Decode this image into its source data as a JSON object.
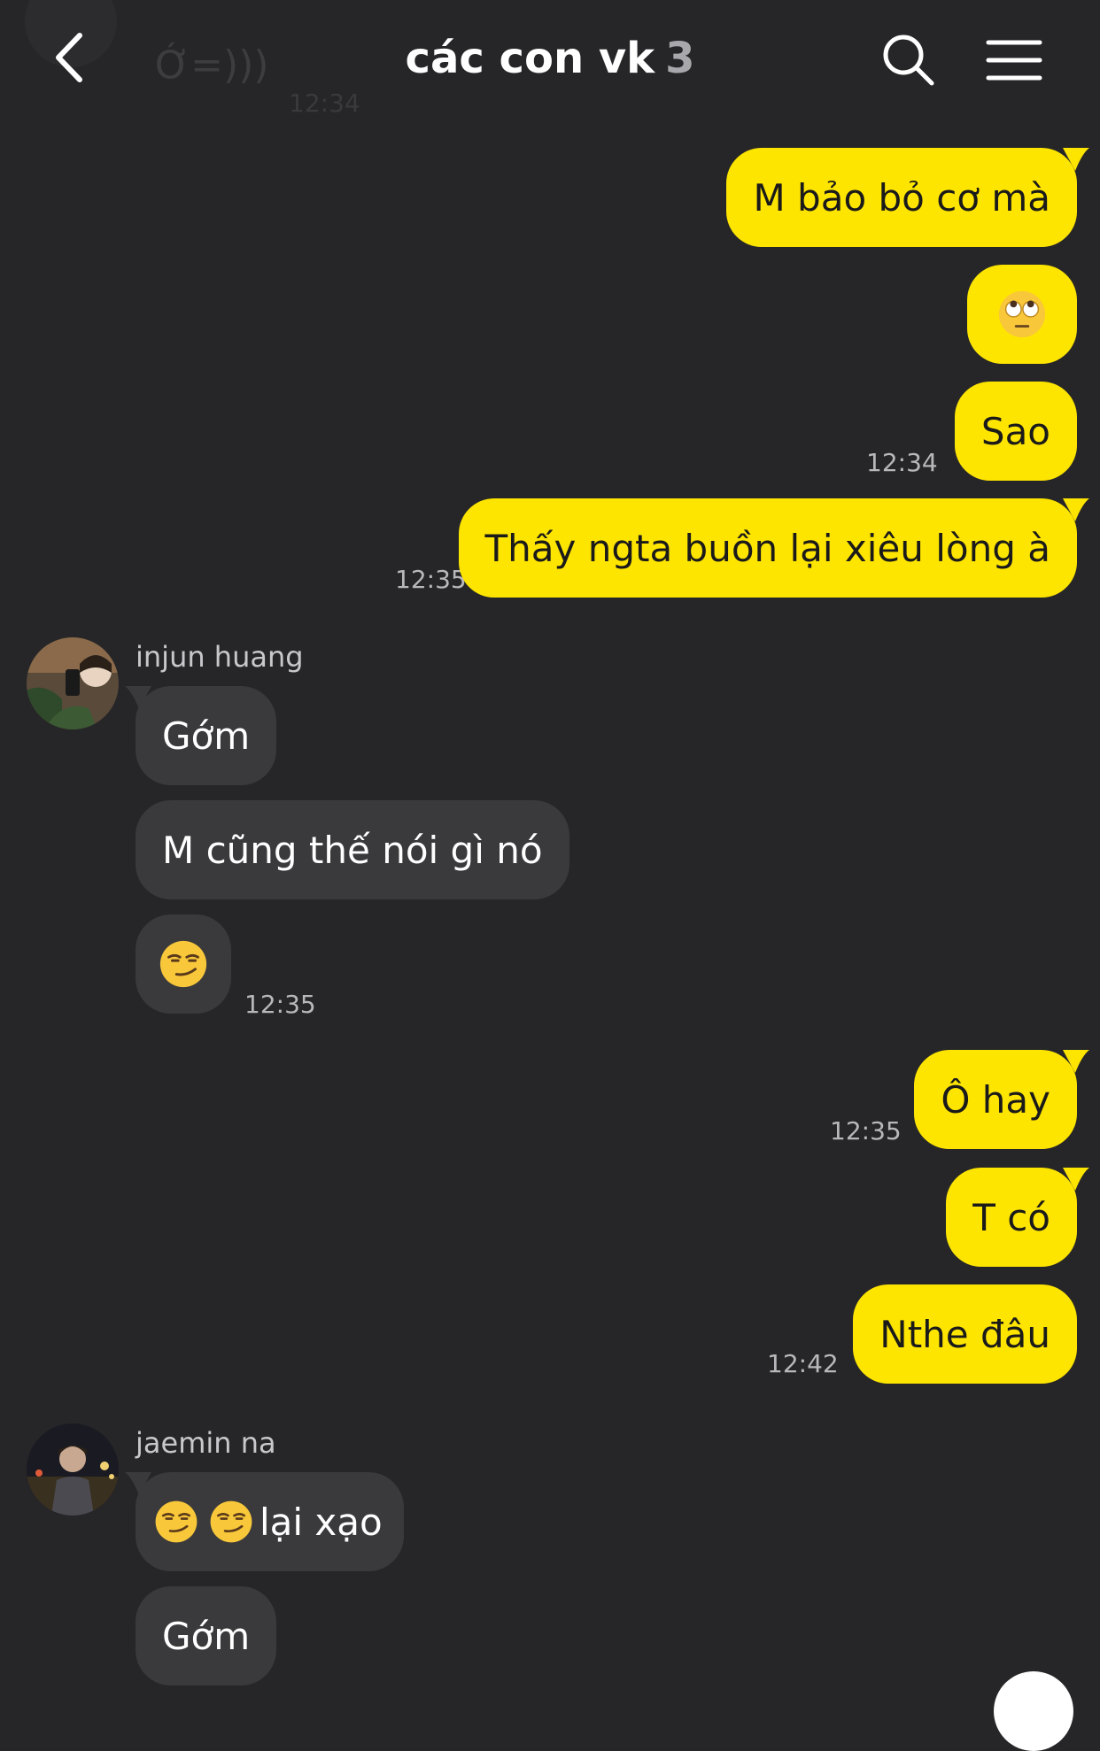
{
  "header": {
    "title": "các con vk",
    "member_count": "3",
    "prev_message_text": "Ớ=)))",
    "prev_message_time": "12:34"
  },
  "messages": {
    "m1": {
      "text": "M bảo bỏ cơ mà"
    },
    "m2": {
      "emoji": "face-with-rolling-eyes"
    },
    "m3": {
      "text": "Sao",
      "time": "12:34"
    },
    "m4": {
      "text": "Thấy ngta buồn lại xiêu lòng à",
      "time": "12:35"
    },
    "g1": {
      "sender": "injun huang",
      "b1": "Gớm",
      "b2": "M cũng thế nói gì nó",
      "b3_emoji": "smirking-face",
      "time": "12:35"
    },
    "m5": {
      "text": "Ô hay",
      "time": "12:35"
    },
    "m6": {
      "text": "T có"
    },
    "m7": {
      "text": "Nthe đâu",
      "time": "12:42"
    },
    "g2": {
      "sender": "jaemin na",
      "b1_text": "lại xạo",
      "b1_emojis": [
        "smirking-face",
        "smirking-face"
      ],
      "b2": "Gớm"
    }
  },
  "colors": {
    "background": "#262628",
    "my_bubble": "#fee500",
    "their_bubble": "#3a3a3c"
  }
}
